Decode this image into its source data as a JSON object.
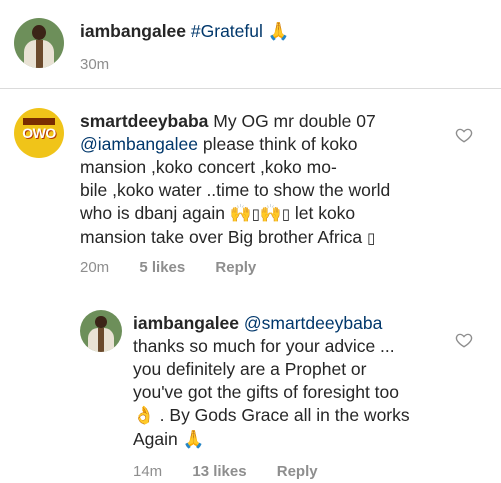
{
  "caption": {
    "username": "iambangalee",
    "hashtag": "#Grateful",
    "emoji": "🙏",
    "time": "30m"
  },
  "comments": [
    {
      "username": "smartdeeybaba",
      "avatar_text": "OWO",
      "text_part1": "My OG mr double 07",
      "mention": "@iambangalee",
      "line2": "please think of koko",
      "line3": "mansion ,koko concert ,koko mo-",
      "line4": "bile ,koko water ..time to show the world",
      "line5_start": "who is dbanj again",
      "emoji1": "🙌",
      "box1": "▯",
      "emoji2": "🙌",
      "box2": "▯",
      "line5_end": "let koko",
      "line6": "mansion take over Big brother Africa",
      "box3": "▯",
      "time": "20m",
      "likes": "5 likes",
      "reply": "Reply"
    },
    {
      "username": "iambangalee",
      "mention": "@smartdeeybaba",
      "line2": "thanks so much for your advice ...",
      "line3": "you definitely are a Prophet or",
      "line4": "you've got the gifts of foresight too",
      "emoji_ok": "👌",
      "line5": ". By Gods Grace all in the works",
      "line6": "Again",
      "emoji_end": "🙏",
      "time": "14m",
      "likes": "13 likes",
      "reply": "Reply"
    }
  ],
  "icons": {
    "like": "heart-outline-icon"
  },
  "colors": {
    "text": "#262626",
    "link": "#00376b",
    "meta": "#8e8e8e",
    "divider": "#dbdbdb"
  }
}
